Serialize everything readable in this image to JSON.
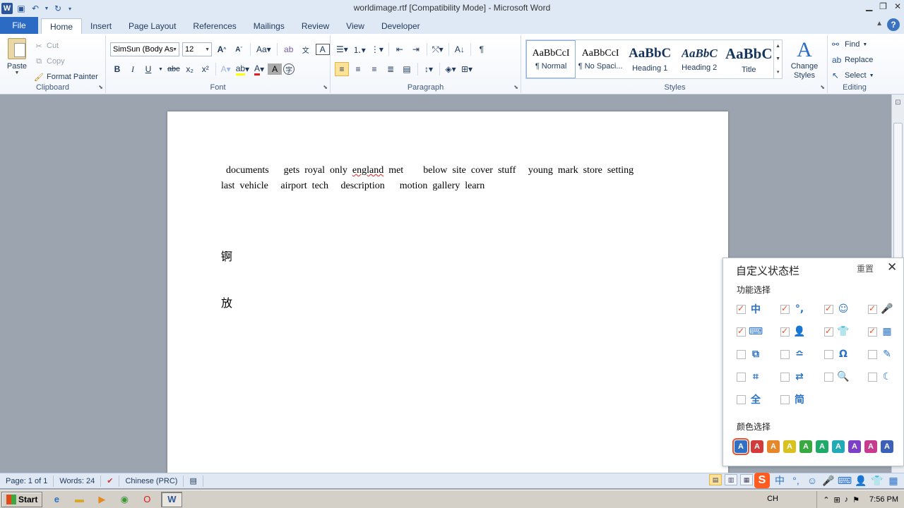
{
  "window": {
    "title": "worldimage.rtf [Compatibility Mode]  -  Microsoft Word"
  },
  "tabs": [
    "File",
    "Home",
    "Insert",
    "Page Layout",
    "References",
    "Mailings",
    "Review",
    "View",
    "Developer"
  ],
  "active_tab": "Home",
  "clipboard": {
    "paste": "Paste",
    "cut": "Cut",
    "copy": "Copy",
    "format_painter": "Format Painter",
    "label": "Clipboard"
  },
  "font": {
    "name": "SimSun (Body As",
    "size": "12",
    "label": "Font"
  },
  "paragraph": {
    "label": "Paragraph"
  },
  "styles": {
    "items": [
      {
        "sample": "AaBbCcI",
        "name": "¶ Normal"
      },
      {
        "sample": "AaBbCcI",
        "name": "¶ No Spaci..."
      },
      {
        "sample": "AaBbC",
        "name": "Heading 1"
      },
      {
        "sample": "AaBbC",
        "name": "Heading 2"
      },
      {
        "sample": "AaBbC",
        "name": "Title"
      }
    ],
    "change_styles": "Change Styles",
    "label": "Styles"
  },
  "editing": {
    "find": "Find",
    "replace": "Replace",
    "select": "Select",
    "label": "Editing"
  },
  "document": {
    "line1_a": "  documents      gets  royal  only  ",
    "line1_b": "england",
    "line1_c": "  met        below  site  cover  stuff     young  mark  store  setting",
    "line2": "last  vehicle     airport  tech     description      motion  gallery  learn",
    "char1": "锕",
    "char2": "放"
  },
  "statusbar": {
    "page": "Page: 1 of 1",
    "words": "Words: 24",
    "language": "Chinese (PRC)"
  },
  "panel": {
    "title": "自定义状态栏",
    "reset": "重置",
    "func_section": "功能选择",
    "color_section": "颜色选择",
    "options": [
      {
        "icon": "中",
        "checked": true
      },
      {
        "icon": "°,",
        "checked": true
      },
      {
        "icon": "☺",
        "checked": true
      },
      {
        "icon": "🎤",
        "checked": true
      },
      {
        "icon": "⌨",
        "checked": true
      },
      {
        "icon": "👤",
        "checked": true
      },
      {
        "icon": "👕",
        "checked": true
      },
      {
        "icon": "▦",
        "checked": true
      },
      {
        "icon": "⧉",
        "checked": false
      },
      {
        "icon": "≏",
        "checked": false
      },
      {
        "icon": "Ω",
        "checked": false
      },
      {
        "icon": "✎",
        "checked": false
      },
      {
        "icon": "⌗",
        "checked": false
      },
      {
        "icon": "⇄",
        "checked": false
      },
      {
        "icon": "🔍",
        "checked": false
      },
      {
        "icon": "☾",
        "checked": false
      },
      {
        "icon": "全",
        "checked": false
      },
      {
        "icon": "简",
        "checked": false
      }
    ],
    "colors": [
      "#2f6fc6",
      "#d33b3b",
      "#e8862a",
      "#d9c21e",
      "#38a840",
      "#1eab6a",
      "#22aab7",
      "#7d3fc7",
      "#c83a8f",
      "#3c5fb7"
    ]
  },
  "taskbar": {
    "start": "Start",
    "lang": "CH",
    "time": "7:56 PM"
  }
}
